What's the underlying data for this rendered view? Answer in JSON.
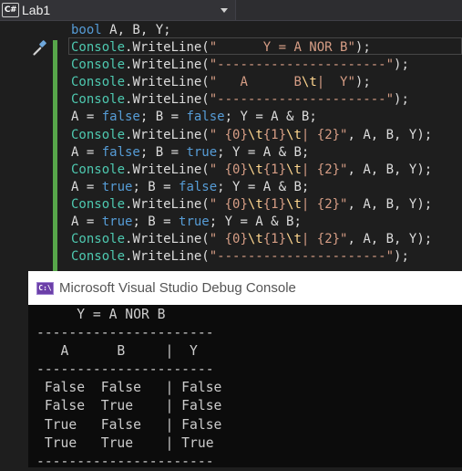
{
  "tab": {
    "project": "Lab1",
    "language_badge": "C#"
  },
  "editor": {
    "line0": {
      "kw": "bool",
      "rest": " A, B, Y;"
    },
    "header_lines": [
      {
        "cls": "Console",
        "mid": ".WriteLine(",
        "str": "\"      Y = A NOR B\"",
        "end": ");"
      },
      {
        "cls": "Console",
        "mid": ".WriteLine(",
        "str": "\"----------------------\"",
        "end": ");"
      },
      {
        "cls": "Console",
        "mid": ".WriteLine(",
        "s1": "\"   A      B",
        "esc": "\\t",
        "s2": "|  Y\"",
        "end": ");"
      },
      {
        "cls": "Console",
        "mid": ".WriteLine(",
        "str": "\"----------------------\"",
        "end": ");"
      }
    ],
    "cases": [
      {
        "a_lhs": "A = ",
        "a_val": "false",
        "b_lhs": "; B = ",
        "b_val": "false",
        "y_expr": "; Y = A & B;"
      },
      {
        "a_lhs": "A = ",
        "a_val": "false",
        "b_lhs": "; B = ",
        "b_val": "true",
        "y_expr": "; Y = A & B;"
      },
      {
        "a_lhs": "A = ",
        "a_val": "true",
        "b_lhs": "; B = ",
        "b_val": "false",
        "y_expr": "; Y = A & B;"
      },
      {
        "a_lhs": "A = ",
        "a_val": "true",
        "b_lhs": "; B = ",
        "b_val": "true",
        "y_expr": "; Y = A & B;"
      }
    ],
    "fmt_line": {
      "cls": "Console",
      "mid": ".WriteLine(",
      "s1": "\" {0}",
      "e1": "\\t",
      "s2": "{1}",
      "e2": "\\t",
      "s3": "| {2}\"",
      "end": ", A, B, Y);"
    },
    "last_line": {
      "cls": "Console",
      "mid": ".WriteLine(",
      "str": "\"----------------------\"",
      "end": ");"
    }
  },
  "console": {
    "title": "Microsoft Visual Studio Debug Console",
    "icon_text": "C:\\",
    "lines": [
      "     Y = A NOR B",
      "----------------------",
      "   A      B     |  Y",
      "----------------------",
      " False  False   | False",
      " False  True    | False",
      " True   False   | False",
      " True   True    | True",
      "----------------------"
    ]
  }
}
